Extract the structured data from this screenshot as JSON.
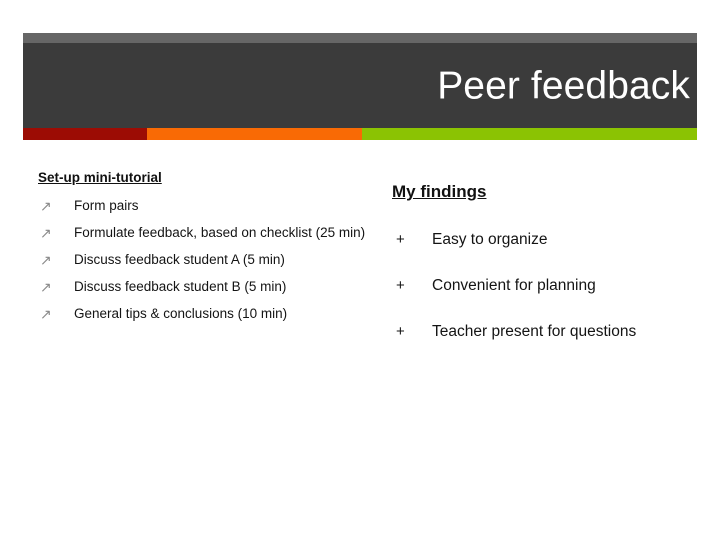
{
  "slide": {
    "title": "Peer feedback",
    "background_color": "#ffffff"
  },
  "banner": {
    "gray_strip_color": "#666666",
    "dark_block_color": "#3b3b3b",
    "title_color": "#ffffff",
    "accent_bar": [
      {
        "name": "dark-red",
        "color": "#9c0c04"
      },
      {
        "name": "orange",
        "color": "#f96a05"
      },
      {
        "name": "green",
        "color": "#8bc303"
      }
    ]
  },
  "left_column": {
    "heading": "Set-up mini-tutorial",
    "bullet_marker": "↗",
    "items": [
      "Form pairs",
      "Formulate feedback, based on checklist (25 min)",
      "Discuss feedback student A (5 min)",
      "Discuss feedback student B (5 min)",
      "General tips & conclusions (10 min)"
    ]
  },
  "right_column": {
    "heading": "My findings",
    "bullet_marker": "+",
    "items": [
      "Easy to organize",
      "Convenient for planning",
      "Teacher present for questions"
    ]
  }
}
